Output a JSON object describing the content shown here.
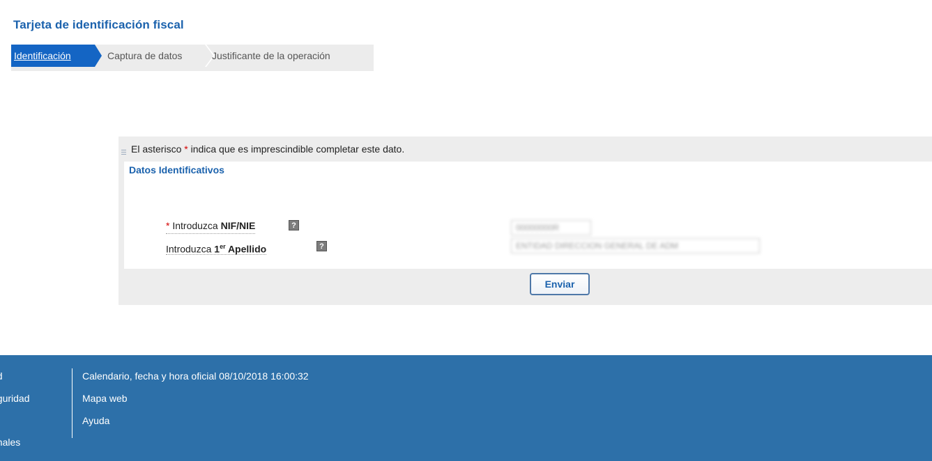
{
  "header": {
    "title": "Tarjeta de identificación fiscal"
  },
  "steps": [
    {
      "label": "Identificación",
      "active": true
    },
    {
      "label": "Captura de datos",
      "active": false
    },
    {
      "label": "Justificante de la operación",
      "active": false
    }
  ],
  "form": {
    "note_prefix": "El asterisco ",
    "note_asterisk": "*",
    "note_suffix": " indica que es imprescindible completar este dato.",
    "section_title": "Datos Identificativos",
    "nif": {
      "required_mark": "*",
      "label_prefix": "Introduzca ",
      "label_strong": "NIF/NIE",
      "help_icon": "?",
      "value": "00000000R"
    },
    "surname": {
      "label_prefix": "Introduzca ",
      "label_strong_a": "1",
      "label_sup": "er",
      "label_strong_b": " Apellido",
      "help_icon": "?",
      "value": "ENTIDAD DIRECCION GENERAL DE ADM"
    },
    "submit_label": "Enviar"
  },
  "footer": {
    "left_items": [
      "ad",
      "eguridad",
      "onales"
    ],
    "links": [
      "Calendario, fecha y hora oficial 08/10/2018 16:00:32",
      "Mapa web",
      "Ayuda"
    ]
  },
  "colors": {
    "title_blue": "#1b62ad",
    "active_step": "#1465c4",
    "footer_blue": "#2d70a9",
    "required_red": "#d40000"
  }
}
